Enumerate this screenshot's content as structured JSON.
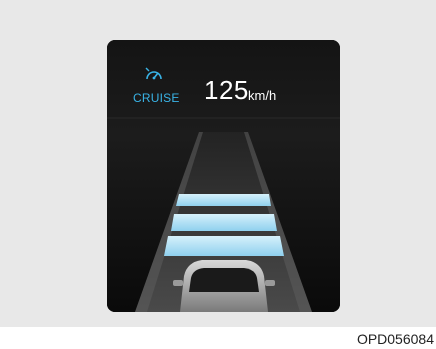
{
  "display": {
    "indicator_label": "CRUISE",
    "speed_value": "125",
    "speed_unit": "km/h",
    "gap_bars_lit": 3,
    "icon": "cruise-speedometer-icon",
    "colors": {
      "accent": "#39b3e6",
      "bar": "#a9dcf3",
      "screen": "#0d0d0d",
      "road": "#383838"
    }
  },
  "figure": {
    "caption": "OPD056084"
  }
}
